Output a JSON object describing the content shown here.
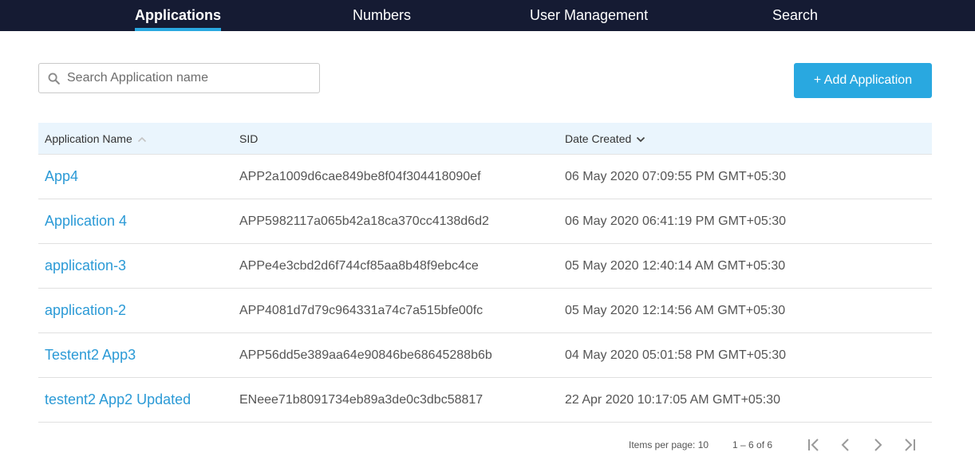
{
  "nav": {
    "tabs": [
      {
        "label": "Applications",
        "active": true
      },
      {
        "label": "Numbers",
        "active": false
      },
      {
        "label": "User Management",
        "active": false
      },
      {
        "label": "Search",
        "active": false
      }
    ]
  },
  "toolbar": {
    "search_placeholder": "Search Application name",
    "search_value": "",
    "add_label": "+ Add Application"
  },
  "table": {
    "headers": {
      "name": "Application Name",
      "sid": "SID",
      "date": "Date Created"
    },
    "rows": [
      {
        "name": "App4",
        "sid": "APP2a1009d6cae849be8f04f304418090ef",
        "date": "06 May 2020 07:09:55 PM GMT+05:30"
      },
      {
        "name": "Application 4",
        "sid": "APP5982117a065b42a18ca370cc4138d6d2",
        "date": "06 May 2020 06:41:19 PM GMT+05:30"
      },
      {
        "name": "application-3",
        "sid": "APPe4e3cbd2d6f744cf85aa8b48f9ebc4ce",
        "date": "05 May 2020 12:40:14 AM GMT+05:30"
      },
      {
        "name": "application-2",
        "sid": "APP4081d7d79c964331a74c7a515bfe00fc",
        "date": "05 May 2020 12:14:56 AM GMT+05:30"
      },
      {
        "name": "Testent2 App3",
        "sid": "APP56dd5e389aa64e90846be68645288b6b",
        "date": "04 May 2020 05:01:58 PM GMT+05:30"
      },
      {
        "name": "testent2 App2 Updated",
        "sid": "ENeee71b8091734eb89a3de0c3dbc58817",
        "date": "22 Apr 2020 10:17:05 AM GMT+05:30"
      }
    ]
  },
  "paginator": {
    "items_per_page": "Items per page: 10",
    "range": "1 – 6 of 6"
  },
  "icons": {
    "search": "search-icon",
    "sort_asc": "sort-asc-icon",
    "sort_desc": "chevron-down-icon",
    "first": "first-page-icon",
    "prev": "chevron-left-icon",
    "next": "chevron-right-icon",
    "last": "last-page-icon"
  },
  "colors": {
    "nav_bg": "#151b33",
    "accent": "#29a8e0",
    "link": "#2b9ad6",
    "header_bg": "#eaf5fd"
  }
}
